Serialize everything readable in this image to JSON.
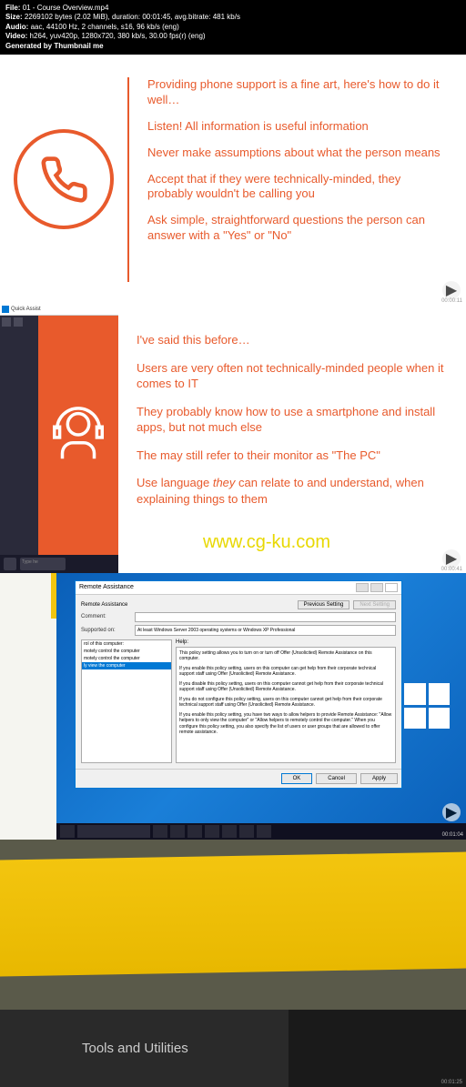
{
  "header": {
    "file_label": "File:",
    "file_value": "01 - Course Overview.mp4",
    "size_label": "Size:",
    "size_value": "2269102 bytes (2.02 MiB), duration: 00:01:45, avg.bitrate: 481 kb/s",
    "audio_label": "Audio:",
    "audio_value": "aac, 44100 Hz, 2 channels, s16, 96 kb/s (eng)",
    "video_label": "Video:",
    "video_value": "h264, yuv420p, 1280x720, 380 kb/s, 30.00 fps(r) (eng)",
    "generated": "Generated by Thumbnail me"
  },
  "slide1": {
    "tips": [
      "Providing phone support is a fine art, here's how to do it well…",
      "Listen!  All information is useful information",
      "Never make assumptions about what the person means",
      "Accept that if they were technically-minded, they probably wouldn't be calling you",
      "Ask simple, straightforward questions the person can answer with a \"Yes\" or \"No\""
    ],
    "timestamp": "00:00:11"
  },
  "slide2": {
    "quick_assist": "Quick Assist",
    "search_placeholder": "Type he",
    "tips": [
      "I've said this before…",
      "Users are very often not technically-minded people when it comes to IT",
      "They probably know how to use a smartphone and install apps, but not much else",
      "The may still refer to their monitor as \"The PC\"",
      "Use language they can relate to and understand, when explaining things to them"
    ],
    "watermark": "www.cg-ku.com",
    "timestamp": "00:00:41"
  },
  "slide3": {
    "dialog_title": "Remote Assistance",
    "setting_name": "Remote Assistance",
    "prev_setting": "Previous Setting",
    "next_setting": "Next Setting",
    "comment_label": "Comment:",
    "supported_label": "Supported on:",
    "supported_value": "At least Windows Server 2003 operating systems or Windows XP Professional",
    "left_items": [
      "rol of this computer:",
      "motely control the computer",
      "motely control the computer",
      "ly view the computer"
    ],
    "help_label": "Help:",
    "help_text": [
      "This policy setting allows you to turn on or turn off Offer (Unsolicited) Remote Assistance on this computer.",
      "If you enable this policy setting, users on this computer can get help from their corporate technical support staff using Offer (Unsolicited) Remote Assistance.",
      "If you disable this policy setting, users on this computer cannot get help from their corporate technical support staff using Offer (Unsolicited) Remote Assistance.",
      "If you do not configure this policy setting, users on this computer cannot get help from their corporate technical support staff using Offer (Unsolicited) Remote Assistance.",
      "If you enable this policy setting, you have two ways to allow helpers to provide Remote Assistance: \"Allow helpers to only view the computer\" or \"Allow helpers to remotely control the computer.\" When you configure this policy setting, you also specify the list of users or user groups that are allowed to offer remote assistance."
    ],
    "buttons": {
      "ok": "OK",
      "cancel": "Cancel",
      "apply": "Apply"
    },
    "timestamp": "00:01:04"
  },
  "slide4": {
    "text": "Tools and Utilities",
    "timestamp": "00:01:25"
  }
}
